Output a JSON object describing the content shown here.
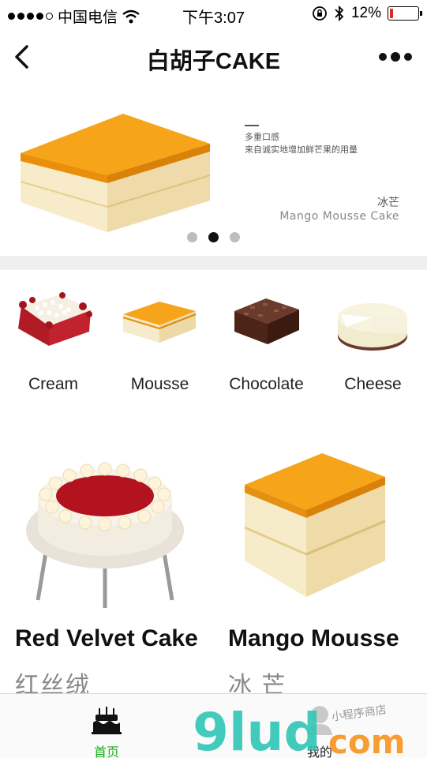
{
  "status_bar": {
    "carrier": "中国电信",
    "time": "下午3:07",
    "battery": "12%",
    "battery_level": 0.12,
    "battery_color": "#e0282b"
  },
  "nav": {
    "title": "白胡子CAKE",
    "back_icon": "chevron-left-icon",
    "more_icon": "more-dots-icon"
  },
  "banner": {
    "line1": "多重口感",
    "line2": "来自诚实地增加鲜芒果的用量",
    "name_zh": "冰芒",
    "name_en": "Mango Mousse Cake",
    "slide_count": 3,
    "active_slide": 2
  },
  "categories": [
    {
      "label": "Cream",
      "icon": "cream-cake-icon"
    },
    {
      "label": "Mousse",
      "icon": "mousse-cake-icon"
    },
    {
      "label": "Chocolate",
      "icon": "chocolate-cake-icon"
    },
    {
      "label": "Cheese",
      "icon": "cheese-cake-icon"
    }
  ],
  "products": [
    {
      "name": "Red Velvet Cake",
      "sub": "红丝绒",
      "image": "red-velvet-cake-image"
    },
    {
      "name": "Mango Mousse",
      "sub": "冰 芒",
      "image": "mango-mousse-image"
    }
  ],
  "tabs": [
    {
      "label": "首页",
      "icon": "cake-icon",
      "active": true
    },
    {
      "label": "我的",
      "icon": "user-icon",
      "active": false
    }
  ],
  "watermark": {
    "brand": "9lud",
    "suffix": "com",
    "tagline": "小程序商店"
  },
  "colors": {
    "accent_green": "#1aad19",
    "mango": "#f5a623",
    "watermark_teal": "#2fc7b6",
    "watermark_orange": "#f7941d"
  }
}
